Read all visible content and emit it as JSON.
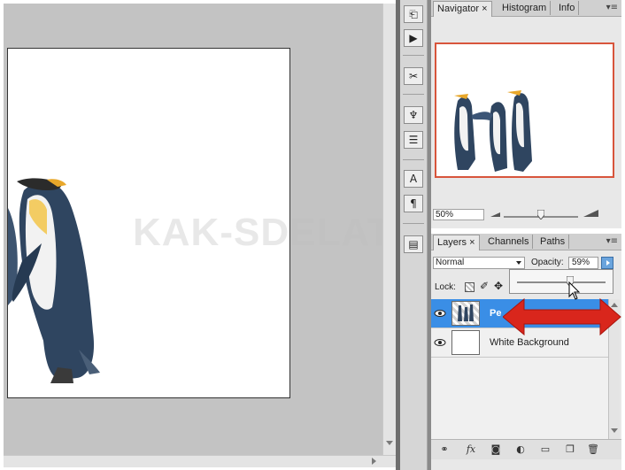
{
  "navigator_panel": {
    "tabs": [
      {
        "label": "Navigator",
        "close": "×",
        "active": true
      },
      {
        "label": "Histogram",
        "active": false
      },
      {
        "label": "Info",
        "active": false
      }
    ],
    "zoom_value": "50%",
    "menu_glyph": "▾≡"
  },
  "layers_panel": {
    "tabs": [
      {
        "label": "Layers",
        "close": "×",
        "active": true
      },
      {
        "label": "Channels",
        "active": false
      },
      {
        "label": "Paths",
        "active": false
      }
    ],
    "blend_mode": "Normal",
    "opacity_label": "Opacity:",
    "opacity_value": "59%",
    "opacity_slider_fraction": 0.59,
    "lock_label": "Lock:",
    "layers": [
      {
        "name": "Pe",
        "selected": true
      },
      {
        "name": "White Background",
        "selected": false
      }
    ],
    "menu_glyph": "▾≡"
  },
  "tools": [
    "history-icon",
    "actions-icon",
    "tools-preset-icon",
    "clone-source-icon",
    "layer-comps-icon",
    "character-icon",
    "paragraph-icon",
    "notes-icon"
  ],
  "colors": {
    "accent_blue": "#3a8ee6",
    "arrow_red": "#d9261c",
    "navigator_frame": "#d8553c"
  },
  "watermark": "KAK-SDELAT"
}
